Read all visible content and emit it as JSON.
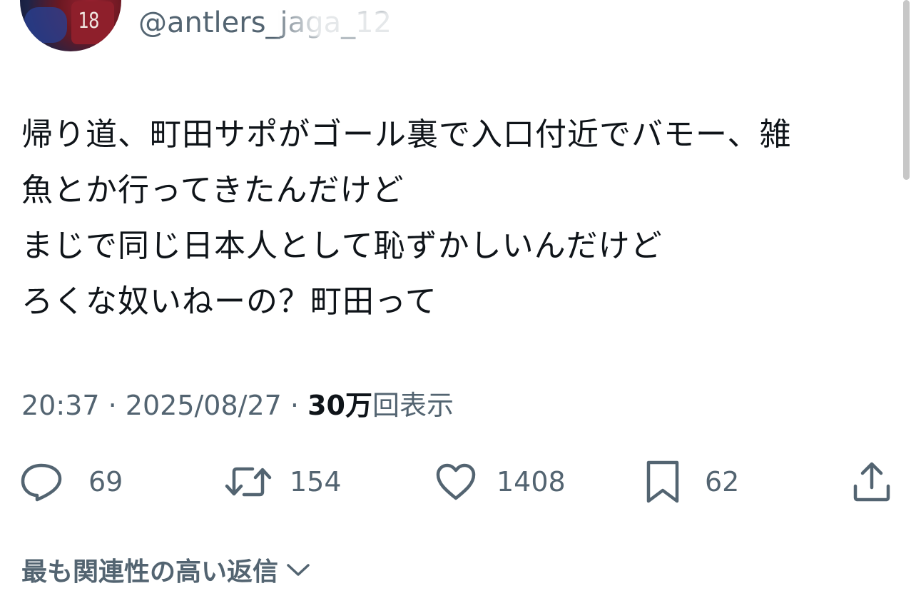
{
  "user": {
    "handle": "@antlers_jaga_12",
    "jersey_number": "18"
  },
  "tweet": {
    "lines": [
      "帰り道、町田サポがゴール裏で入口付近でバモー、雑",
      "魚とか行ってきたんだけど",
      "まじで同じ日本人として恥ずかしいんだけど",
      "ろくな奴いねーの？町田って"
    ],
    "time": "20:37",
    "separator": "·",
    "date": "2025/08/27",
    "views_count": "30万",
    "views_label": "回表示"
  },
  "actions": {
    "replies": "69",
    "retweets": "154",
    "likes": "1408",
    "bookmarks": "62"
  },
  "replies_sort": {
    "label": "最も関連性の高い返信"
  },
  "colors": {
    "text": "#0f1419",
    "secondary": "#536471"
  }
}
